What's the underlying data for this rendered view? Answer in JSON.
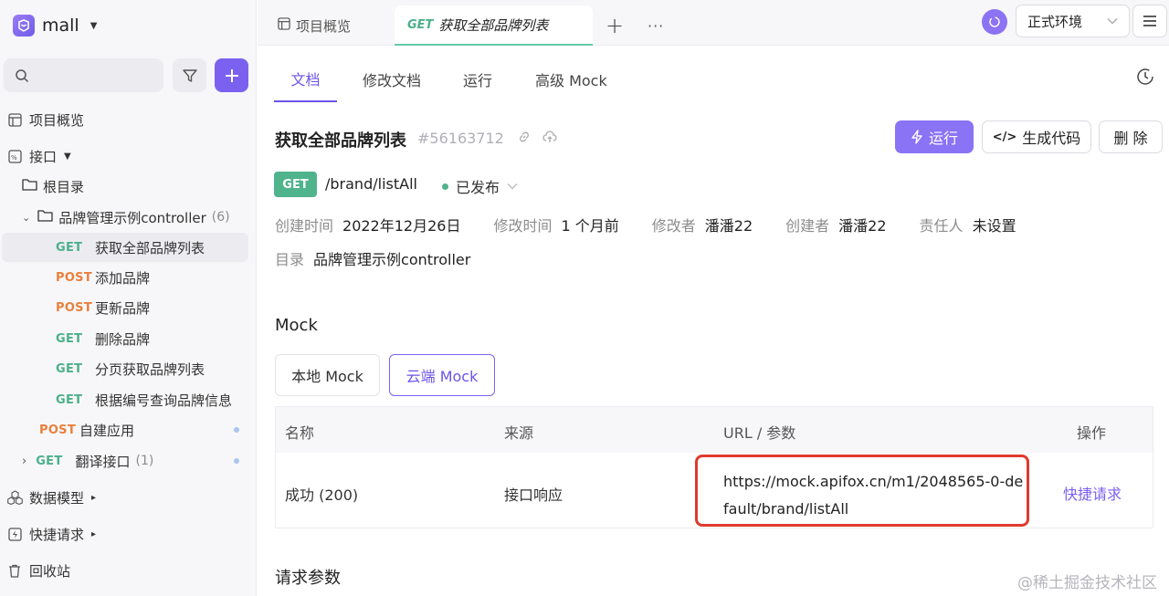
{
  "sidebar": {
    "project_name": "mall",
    "items": {
      "overview": "项目概览",
      "api": "接口",
      "root": "根目录",
      "folder": "品牌管理示例controller",
      "folder_count": "(6)",
      "data_model": "数据模型",
      "quick_request": "快捷请求",
      "recycle": "回收站"
    },
    "endpoints": [
      {
        "method": "GET",
        "name": "获取全部品牌列表"
      },
      {
        "method": "POST",
        "name": "添加品牌"
      },
      {
        "method": "POST",
        "name": "更新品牌"
      },
      {
        "method": "GET",
        "name": "删除品牌"
      },
      {
        "method": "GET",
        "name": "分页获取品牌列表"
      },
      {
        "method": "GET",
        "name": "根据编号查询品牌信息"
      }
    ],
    "extra": [
      {
        "method": "POST",
        "name": "自建应用"
      },
      {
        "method": "GET",
        "name": "翻译接口",
        "count": "(1)"
      }
    ]
  },
  "tabbar": {
    "tab_overview": "项目概览",
    "tab_active_method": "GET",
    "tab_active_title": "获取全部品牌列表",
    "add": "+",
    "more": "···",
    "env": "正式环境"
  },
  "subtabs": [
    "文档",
    "修改文档",
    "运行",
    "高级 Mock"
  ],
  "api": {
    "title": "获取全部品牌列表",
    "id": "#56163712",
    "run_label": "运行",
    "gen_code_label": "生成代码",
    "delete_label": "删 除",
    "method": "GET",
    "path": "/brand/listAll",
    "status": "已发布"
  },
  "meta": {
    "created_label": "创建时间",
    "created": "2022年12月26日",
    "modified_label": "修改时间",
    "modified": "1 个月前",
    "modifier_label": "修改者",
    "modifier": "潘潘22",
    "creator_label": "创建者",
    "creator": "潘潘22",
    "owner_label": "责任人",
    "owner": "未设置",
    "dir_label": "目录",
    "dir": "品牌管理示例controller"
  },
  "mock": {
    "title": "Mock",
    "local_tab": "本地 Mock",
    "cloud_tab": "云端 Mock",
    "headers": [
      "名称",
      "来源",
      "URL / 参数",
      "操作"
    ],
    "row": {
      "name": "成功 (200)",
      "source": "接口响应",
      "url": "https://mock.apifox.cn/m1/2048565-0-default/brand/listAll",
      "action": "快捷请求"
    }
  },
  "request_params_title": "请求参数",
  "watermark": "@稀土掘金技术社区",
  "colors": {
    "accent": "#7b61f0",
    "get": "#4fb38c",
    "post": "#e9803c",
    "highlight": "#e03a2e"
  }
}
